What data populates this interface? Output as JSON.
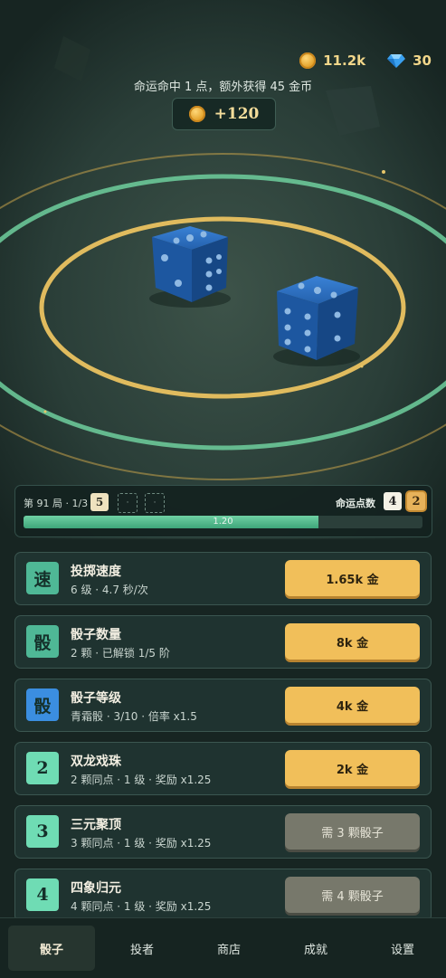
{
  "currency": {
    "coins": "11.2k",
    "gems": "30"
  },
  "fate_message": "命运命中 1 点，额外获得 45 金币",
  "reward": {
    "amount": "+120"
  },
  "round": {
    "label": "第 91 局 · 1/3",
    "slots": [
      "5",
      "·",
      "·"
    ],
    "fate_label": "命运点数",
    "fate_numbers": [
      "4",
      "2"
    ],
    "progress_text": "1.20",
    "progress_fraction": 0.74
  },
  "upgrades": [
    {
      "badge": "速",
      "badge_color": "#4fb896",
      "title": "投掷速度",
      "subtitle": "6 级 · 4.7 秒/次",
      "button": "1.65k 金",
      "locked": false
    },
    {
      "badge": "骰",
      "badge_color": "#4fb896",
      "title": "骰子数量",
      "subtitle": "2 颗 · 已解锁 1/5 阶",
      "button": "8k 金",
      "locked": false
    },
    {
      "badge": "骰",
      "badge_color": "#3b8ee0",
      "title": "骰子等级",
      "subtitle": "青霜骰 · 3/10 · 倍率 x1.5",
      "button": "4k 金",
      "locked": false
    },
    {
      "badge": "2",
      "badge_color": "#6fdcb4",
      "title": "双龙戏珠",
      "subtitle": "2 颗同点 · 1 级 · 奖励 x1.25",
      "button": "2k 金",
      "locked": false
    },
    {
      "badge": "3",
      "badge_color": "#6fdcb4",
      "title": "三元聚顶",
      "subtitle": "3 颗同点 · 1 级 · 奖励 x1.25",
      "button": "需 3 颗骰子",
      "locked": true
    },
    {
      "badge": "4",
      "badge_color": "#6fdcb4",
      "title": "四象归元",
      "subtitle": "4 颗同点 · 1 级 · 奖励 x1.25",
      "button": "需 4 颗骰子",
      "locked": true
    }
  ],
  "tabs": [
    "骰子",
    "投者",
    "商店",
    "成就",
    "设置"
  ],
  "active_tab": 0,
  "colors": {
    "accent_gold": "#f1bf5a",
    "ring_gold": "#e0bb5e",
    "ring_green": "#6fcf9e",
    "dice_blue": "#1f5fb0"
  }
}
